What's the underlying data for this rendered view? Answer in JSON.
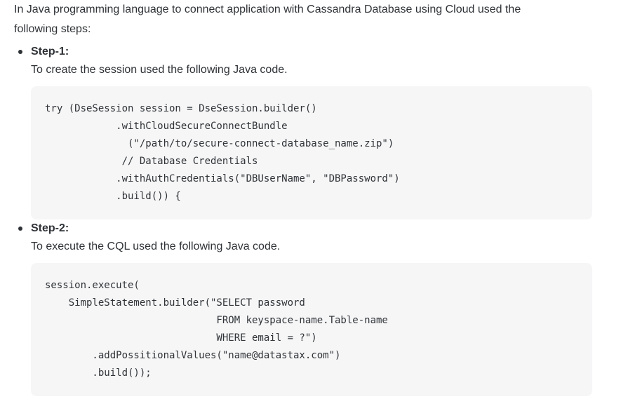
{
  "intro": "In Java programming language to connect application with Cassandra Database using Cloud used the\nfollowing steps:",
  "steps": [
    {
      "title": "Step-1:",
      "description": "To create the session used the following Java code.",
      "code_lines": [
        "try (DseSession session = DseSession.builder()",
        "            .withCloudSecureConnectBundle",
        "              (\"/path/to/secure-connect-database_name.zip\")",
        "             // Database Credentials",
        "            .withAuthCredentials(\"DBUserName\", \"DBPassword\")",
        "            .build()) {"
      ]
    },
    {
      "title": "Step-2:",
      "description": "To execute the CQL used the following Java code.",
      "code_lines": [
        "session.execute(",
        "    SimpleStatement.builder(\"SELECT password",
        "                             FROM keyspace-name.Table-name",
        "                             WHERE email = ?\")",
        "        .addPossitionalValues(\"name@datastax.com\")",
        "        .build());"
      ]
    }
  ]
}
